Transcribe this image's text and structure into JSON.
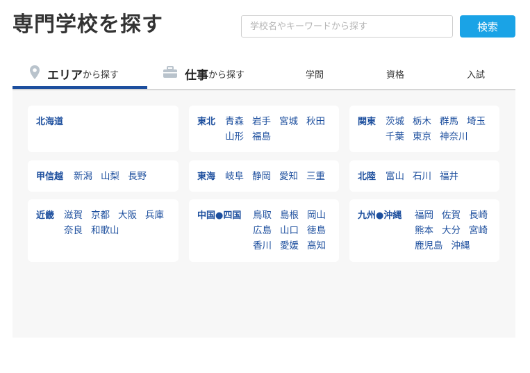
{
  "page": {
    "title": "専門学校を探す"
  },
  "search": {
    "placeholder": "学校名やキーワードから探す",
    "button_label": "検索"
  },
  "tabs": [
    {
      "main": "エリア",
      "sub": "から探す",
      "icon": "map-pin-icon",
      "active": true
    },
    {
      "main": "仕事",
      "sub": "から探す",
      "icon": "briefcase-icon",
      "active": false
    },
    {
      "label": "学問"
    },
    {
      "label": "資格"
    },
    {
      "label": "入試"
    }
  ],
  "colors": {
    "accent_blue": "#1d4f9e",
    "button_blue": "#1aa3e6",
    "panel_bg": "#f7f7f7"
  },
  "regions": [
    {
      "name": "北海道",
      "prefectures": []
    },
    {
      "name": "東北",
      "prefectures": [
        "青森",
        "岩手",
        "宮城",
        "秋田",
        "山形",
        "福島"
      ]
    },
    {
      "name": "関東",
      "prefectures": [
        "茨城",
        "栃木",
        "群馬",
        "埼玉",
        "千葉",
        "東京",
        "神奈川"
      ]
    },
    {
      "name": "甲信越",
      "prefectures": [
        "新潟",
        "山梨",
        "長野"
      ]
    },
    {
      "name": "東海",
      "prefectures": [
        "岐阜",
        "静岡",
        "愛知",
        "三重"
      ]
    },
    {
      "name": "北陸",
      "prefectures": [
        "富山",
        "石川",
        "福井"
      ]
    },
    {
      "name": "近畿",
      "prefectures": [
        "滋賀",
        "京都",
        "大阪",
        "兵庫",
        "奈良",
        "和歌山"
      ]
    },
    {
      "name": "中国●四国",
      "prefectures": [
        "鳥取",
        "島根",
        "岡山",
        "広島",
        "山口",
        "徳島",
        "香川",
        "愛媛",
        "高知"
      ]
    },
    {
      "name": "九州●沖縄",
      "prefectures": [
        "福岡",
        "佐賀",
        "長崎",
        "熊本",
        "大分",
        "宮崎",
        "鹿児島",
        "沖縄"
      ]
    }
  ]
}
